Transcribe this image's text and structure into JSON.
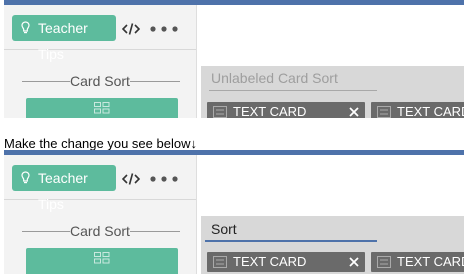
{
  "caption": "Make the change you see below↓",
  "before": {
    "teacher_tips_label": "Teacher Tips",
    "left_heading": "Card Sort",
    "card_sort_title": "Unlabeled Card Sort",
    "cards": [
      "TEXT CARD",
      "TEXT CARD"
    ]
  },
  "after": {
    "teacher_tips_label": "Teacher Tips",
    "left_heading": "Card Sort",
    "card_sort_title": "Sort",
    "cards": [
      "TEXT CARD",
      "TEXT CARD"
    ]
  },
  "colors": {
    "accent_blue": "#4e72aa",
    "button_green": "#5dbb9d",
    "card_gray": "#6a6a6a",
    "panel_gray": "#d8d8d8"
  },
  "icons": {
    "tips": "lightbulb-icon",
    "embed": "code-icon",
    "more": "more-dots-icon",
    "component": "card-grid-icon",
    "card_grip": "grip-icon",
    "card_remove": "close-icon"
  }
}
